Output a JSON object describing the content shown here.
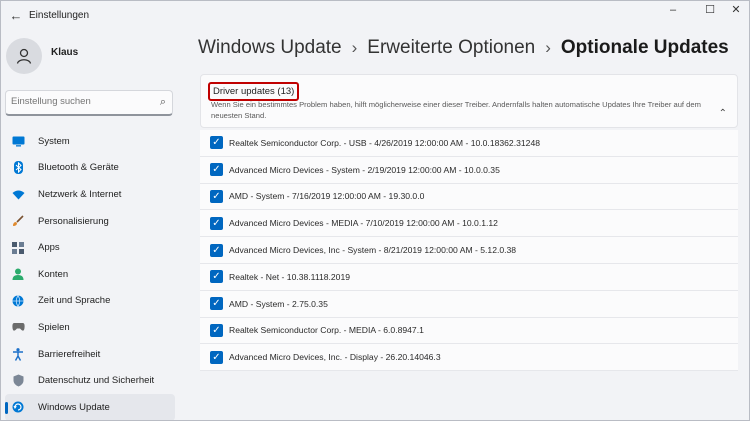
{
  "window": {
    "title": "Einstellungen",
    "back_glyph": "←",
    "controls": [
      "–",
      "☐",
      "✕"
    ]
  },
  "user": {
    "name": "Klaus"
  },
  "search": {
    "placeholder": "Einstellung suchen",
    "icon": "search-icon"
  },
  "sidebar": {
    "items": [
      {
        "label": "System",
        "icon": "system-icon",
        "color": "#0078d4"
      },
      {
        "label": "Bluetooth & Geräte",
        "icon": "bluetooth-icon",
        "color": "#0078d4"
      },
      {
        "label": "Netzwerk & Internet",
        "icon": "wifi-icon",
        "color": "#0078d4"
      },
      {
        "label": "Personalisierung",
        "icon": "brush-icon",
        "color": "#e08a2e"
      },
      {
        "label": "Apps",
        "icon": "apps-icon",
        "color": "#4a5a6e"
      },
      {
        "label": "Konten",
        "icon": "account-icon",
        "color": "#2bab6c"
      },
      {
        "label": "Zeit und Sprache",
        "icon": "globe-icon",
        "color": "#0078d4"
      },
      {
        "label": "Spielen",
        "icon": "gamepad-icon",
        "color": "#6b6b6b"
      },
      {
        "label": "Barrierefreiheit",
        "icon": "accessibility-icon",
        "color": "#1a6fc9"
      },
      {
        "label": "Datenschutz und Sicherheit",
        "icon": "shield-icon",
        "color": "#7c8796"
      },
      {
        "label": "Windows Update",
        "icon": "update-icon",
        "color": "#0078d4",
        "active": true
      }
    ]
  },
  "breadcrumb": {
    "items": [
      "Windows Update",
      "Erweiterte Optionen"
    ],
    "separator": "›",
    "current": "Optionale Updates"
  },
  "section": {
    "title": "Driver updates (13)",
    "description": "Wenn Sie ein bestimmtes Problem haben, hilft möglicherweise einer dieser Treiber. Andernfalls halten automatische Updates Ihre Treiber auf dem neuesten Stand.",
    "collapse_glyph": "⌃"
  },
  "drivers": [
    {
      "label": "Realtek Semiconductor Corp. - USB - 4/26/2019 12:00:00 AM - 10.0.18362.31248",
      "checked": true
    },
    {
      "label": "Advanced Micro Devices - System - 2/19/2019 12:00:00 AM - 10.0.0.35",
      "checked": true
    },
    {
      "label": "AMD - System - 7/16/2019 12:00:00 AM - 19.30.0.0",
      "checked": true
    },
    {
      "label": "Advanced Micro Devices - MEDIA - 7/10/2019 12:00:00 AM - 10.0.1.12",
      "checked": true
    },
    {
      "label": "Advanced Micro Devices, Inc - System - 8/21/2019 12:00:00 AM - 5.12.0.38",
      "checked": true
    },
    {
      "label": "Realtek - Net - 10.38.1118.2019",
      "checked": true
    },
    {
      "label": "AMD - System - 2.75.0.35",
      "checked": true
    },
    {
      "label": "Realtek Semiconductor Corp. - MEDIA - 6.0.8947.1",
      "checked": true
    },
    {
      "label": "Advanced Micro Devices, Inc. - Display - 26.20.14046.3",
      "checked": true
    }
  ],
  "checkmark": "✓",
  "colors": {
    "accent": "#0067c0",
    "highlight_border": "#c00000"
  }
}
